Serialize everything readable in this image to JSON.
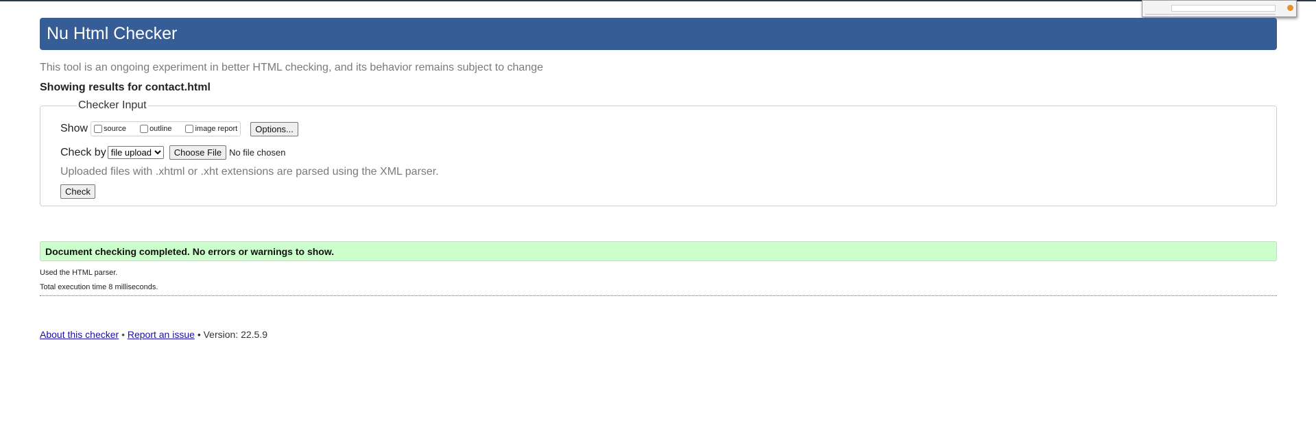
{
  "header": {
    "title": "Nu Html Checker"
  },
  "intro_text": "This tool is an ongoing experiment in better HTML checking, and its behavior remains subject to change",
  "showing_results": "Showing results for contact.html",
  "checker_input": {
    "legend": "Checker Input",
    "show_label": "Show",
    "show_options": [
      {
        "label": "source",
        "checked": false
      },
      {
        "label": "outline",
        "checked": false
      },
      {
        "label": "image report",
        "checked": false
      }
    ],
    "options_button": "Options...",
    "check_by_label": "Check by",
    "check_by_selected": "file upload",
    "choose_file_button": "Choose File",
    "no_file_text": "No file chosen",
    "hint": "Uploaded files with .xhtml or .xht extensions are parsed using the XML parser.",
    "check_button": "Check"
  },
  "result": {
    "success_message": "Document checking completed. No errors or warnings to show.",
    "success_color": "#ccffcc",
    "parser_note": "Used the HTML parser.",
    "execution_time": "Total execution time 8 milliseconds."
  },
  "footer": {
    "about_link": "About this checker",
    "separator": "•",
    "report_link": "Report an issue",
    "version_text": "• Version: 22.5.9"
  },
  "colors": {
    "header_bg": "#365d95",
    "link": "#1a0dab"
  }
}
